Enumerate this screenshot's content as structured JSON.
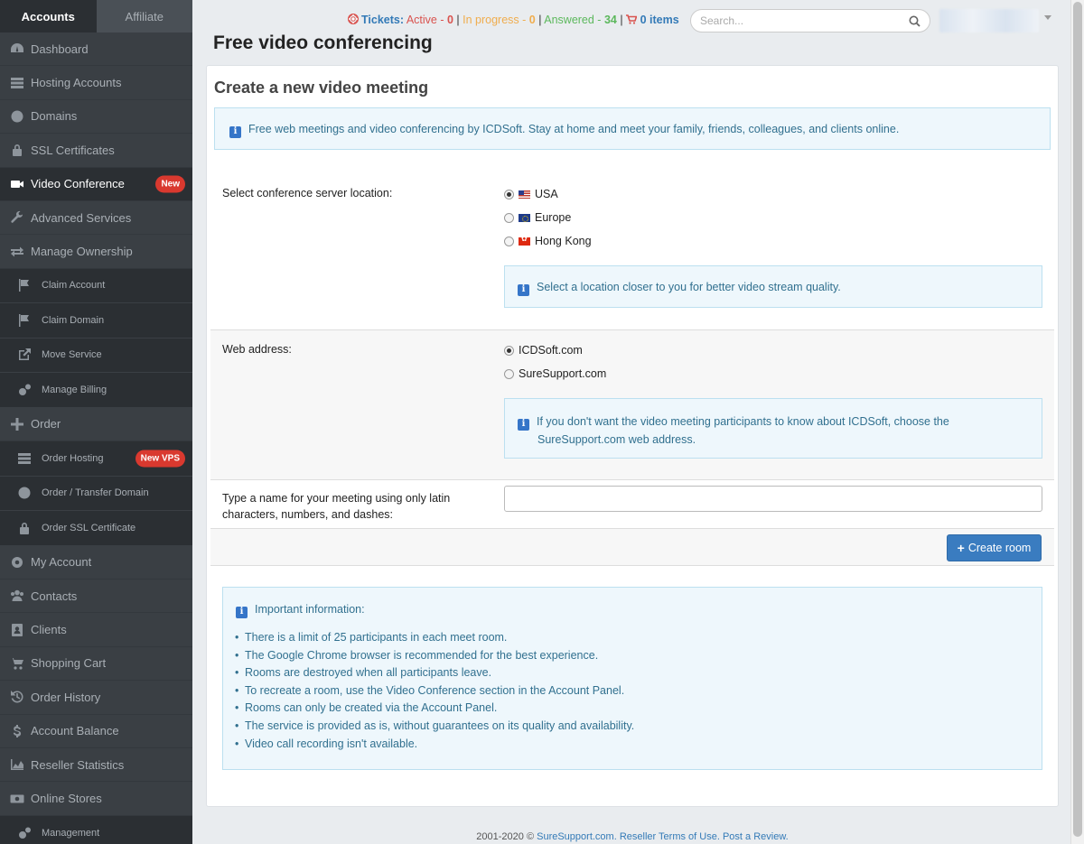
{
  "sidebar": {
    "tabs": [
      {
        "label": "Accounts",
        "active": true
      },
      {
        "label": "Affiliate",
        "active": false
      }
    ],
    "items": [
      {
        "label": "Dashboard",
        "icon": "dashboard-icon"
      },
      {
        "label": "Hosting Accounts",
        "icon": "server-icon"
      },
      {
        "label": "Domains",
        "icon": "globe-icon"
      },
      {
        "label": "SSL Certificates",
        "icon": "lock-icon"
      },
      {
        "label": "Video Conference",
        "icon": "video-camera-icon",
        "badge": "New",
        "active": true
      },
      {
        "label": "Advanced Services",
        "icon": "wrench-icon"
      },
      {
        "label": "Manage Ownership",
        "icon": "exchange-icon"
      },
      {
        "label": "Claim Account",
        "icon": "flag-icon",
        "sub": true
      },
      {
        "label": "Claim Domain",
        "icon": "flag-icon",
        "sub": true
      },
      {
        "label": "Move Service",
        "icon": "external-link-icon",
        "sub": true
      },
      {
        "label": "Manage Billing",
        "icon": "cogs-icon",
        "sub": true
      },
      {
        "label": "Order",
        "icon": "plus-icon"
      },
      {
        "label": "Order Hosting",
        "icon": "server-icon",
        "sub": true,
        "badge": "New VPS"
      },
      {
        "label": "Order / Transfer Domain",
        "icon": "globe-icon",
        "sub": true
      },
      {
        "label": "Order SSL Certificate",
        "icon": "lock-icon",
        "sub": true
      },
      {
        "label": "My Account",
        "icon": "gear-icon"
      },
      {
        "label": "Contacts",
        "icon": "users-icon"
      },
      {
        "label": "Clients",
        "icon": "address-book-icon"
      },
      {
        "label": "Shopping Cart",
        "icon": "cart-icon"
      },
      {
        "label": "Order History",
        "icon": "history-icon"
      },
      {
        "label": "Account Balance",
        "icon": "dollar-icon"
      },
      {
        "label": "Reseller Statistics",
        "icon": "area-chart-icon"
      },
      {
        "label": "Online Stores",
        "icon": "money-icon"
      },
      {
        "label": "Management",
        "icon": "cogs-icon",
        "sub": true
      }
    ]
  },
  "topbar": {
    "tickets_label": "Tickets:",
    "active_label": "Active - ",
    "active_count": "0",
    "in_progress_label": "In progress - ",
    "in_progress_count": "0",
    "answered_label": "Answered - ",
    "answered_count": "34",
    "cart_label": "0 items",
    "search_placeholder": "Search..."
  },
  "page": {
    "title": "Free video conferencing",
    "panel_title": "Create a new video meeting",
    "intro": "Free web meetings and video conferencing by ICDSoft. Stay at home and meet your family, friends, colleagues, and clients online.",
    "location": {
      "label": "Select conference server location:",
      "options": [
        {
          "label": "USA",
          "checked": true,
          "flag": "usa"
        },
        {
          "label": "Europe",
          "checked": false,
          "flag": "eu"
        },
        {
          "label": "Hong Kong",
          "checked": false,
          "flag": "hk"
        }
      ],
      "hint": "Select a location closer to you for better video stream quality."
    },
    "web_address": {
      "label": "Web address:",
      "options": [
        {
          "label": "ICDSoft.com",
          "checked": true
        },
        {
          "label": "SureSupport.com",
          "checked": false
        }
      ],
      "hint": "If you don't want the video meeting participants to know about ICDSoft, choose the SureSupport.com web address."
    },
    "name_field": {
      "label": "Type a name for your meeting using only latin characters, numbers, and dashes:",
      "value": ""
    },
    "create_button": "Create room",
    "important": {
      "title": "Important information:",
      "items": [
        "There is a limit of 25 participants in each meet room.",
        "The Google Chrome browser is recommended for the best experience.",
        "Rooms are destroyed when all participants leave.",
        "To recreate a room, use the Video Conference section in the Account Panel.",
        "Rooms can only be created via the Account Panel.",
        "The service is provided as is, without guarantees on its quality and availability.",
        "Video call recording isn't available."
      ]
    }
  },
  "footer": {
    "copyright": "2001-2020 © ",
    "brand": "SureSupport.com.",
    "terms": "Reseller Terms of Use.",
    "review": "Post a Review."
  },
  "colors": {
    "sidebar_bg": "#3a3f44",
    "sidebar_active": "#2b2f33",
    "badge": "#d9392f",
    "primary_button": "#3a7cc0",
    "info_bg": "#eef7fc",
    "info_text": "#31708f"
  }
}
